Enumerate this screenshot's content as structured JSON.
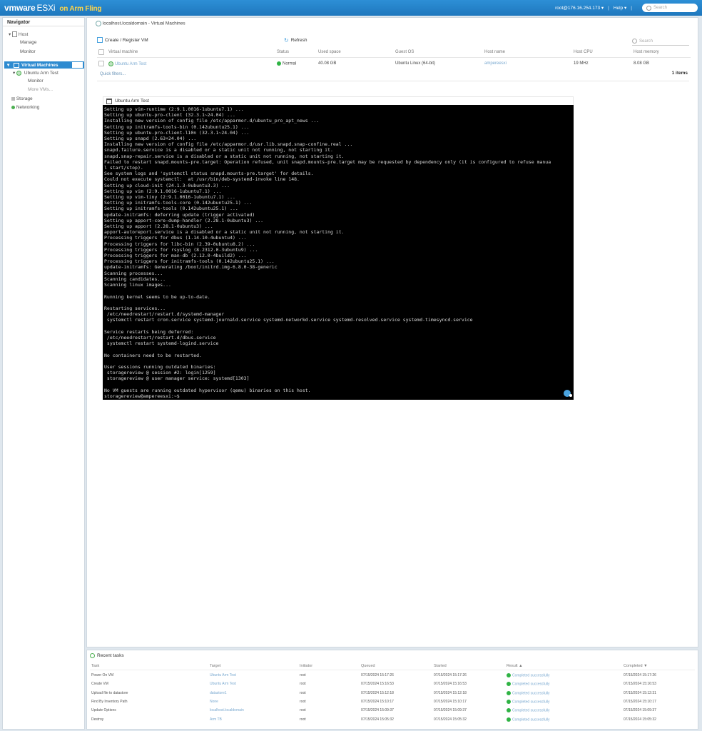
{
  "app": {
    "brand_vmware": "vmware",
    "brand_esxi": "ESXi",
    "brand_fling": "on Arm Fling",
    "user": "root@176.16.254.173 ▾",
    "help": "Help ▾",
    "search_placeholder": "Search"
  },
  "navigator": {
    "title": "Navigator",
    "host": "Host",
    "manage": "Manage",
    "monitor": "Monitor",
    "virtual_machines": "Virtual Machines",
    "vm_name": "Ubuntu Arm Test",
    "vm_monitor": "Monitor",
    "more_vms": "More VMs...",
    "storage": "Storage",
    "networking": "Networking"
  },
  "main": {
    "breadcrumb": "localhost.localdomain - Virtual Machines",
    "create_register": "Create / Register VM",
    "refresh": "Refresh",
    "search_placeholder": "Search",
    "columns": [
      "Virtual machine",
      "Status",
      "Used space",
      "Guest OS",
      "Host name",
      "Host CPU",
      "Host memory"
    ],
    "row": {
      "vm": "Ubuntu Arm Test",
      "status": "Normal",
      "used": "40.08 GB",
      "guest": "Ubuntu Linux (64-bit)",
      "host": "ampereesxi",
      "cpu": "19 MHz",
      "mem": "8.08 GB"
    },
    "quick_filters": "Quick filters...",
    "items_count": "1 items"
  },
  "console": {
    "title": "Ubuntu Arm Test",
    "text": "Setting up vim-runtime (2:9.1.0016-1ubuntu7.1) ...\nSetting up ubuntu-pro-client (32.3.1~24.04) ...\nInstalling new version of config file /etc/apparmor.d/ubuntu_pro_apt_news ...\nSetting up initramfs-tools-bin (0.142ubuntu25.1) ...\nSetting up ubuntu-pro-client-l10n (32.3.1~24.04) ...\nSetting up snapd (2.63+24.04) ...\nInstalling new version of config file /etc/apparmor.d/usr.lib.snapd.snap-confine.real ...\nsnapd.failure.service is a disabled or a static unit not running, not starting it.\nsnapd.snap-repair.service is a disabled or a static unit not running, not starting it.\nFailed to restart snapd.mounts-pre.target: Operation refused, unit snapd.mounts-pre.target may be requested by dependency only (it is configured to refuse manua\nl start/stop).\nSee system logs and 'systemctl status snapd.mounts-pre.target' for details.\nCould not execute systemctl:  at /usr/bin/deb-systemd-invoke line 148.\nSetting up cloud-init (24.1.3-0ubuntu3.3) ...\nSetting up vim (2:9.1.0016-1ubuntu7.1) ...\nSetting up vim-tiny (2:9.1.0016-1ubuntu7.1) ...\nSetting up initramfs-tools-core (0.142ubuntu25.1) ...\nSetting up initramfs-tools (0.142ubuntu25.1) ...\nupdate-initramfs: deferring update (trigger activated)\nSetting up apport-core-dump-handler (2.28.1-0ubuntu3) ...\nSetting up apport (2.28.1-0ubuntu3) ...\napport-autoreport.service is a disabled or a static unit not running, not starting it.\nProcessing triggers for dbus (1.14.10-4ubuntu4) ...\nProcessing triggers for libc-bin (2.39-0ubuntu8.2) ...\nProcessing triggers for rsyslog (8.2312.0-3ubuntu9) ...\nProcessing triggers for man-db (2.12.0-4build2) ...\nProcessing triggers for initramfs-tools (0.142ubuntu25.1) ...\nupdate-initramfs: Generating /boot/initrd.img-6.8.0-38-generic\nScanning processes...\nScanning candidates...\nScanning linux images...\n\nRunning kernel seems to be up-to-date.\n\nRestarting services...\n /etc/needrestart/restart.d/systemd-manager\n systemctl restart cron.service systemd-journald.service systemd-networkd.service systemd-resolved.service systemd-timesyncd.service\n\nService restarts being deferred:\n /etc/needrestart/restart.d/dbus.service\n systemctl restart systemd-logind.service\n\nNo containers need to be restarted.\n\nUser sessions running outdated binaries:\n storagereview @ session #2: login[1259]\n storagereview @ user manager service: systemd[1303]\n\nNo VM guests are running outdated hypervisor (qemu) binaries on this host.\nstoragereview@ampereesxi:~$"
  },
  "tasks": {
    "title": "Recent tasks",
    "columns": [
      "Task",
      "Target",
      "Initiator",
      "Queued",
      "Started",
      "Result ▲",
      "Completed ▼"
    ],
    "rows": [
      {
        "task": "Power On VM",
        "target": "Ubuntu Arm Test",
        "init": "root",
        "queued": "07/15/2024 15:17:26",
        "started": "07/15/2024 15:17:26",
        "result": "Completed successfully",
        "completed": "07/15/2024 15:17:26"
      },
      {
        "task": "Create VM",
        "target": "Ubuntu Arm Test",
        "init": "root",
        "queued": "07/15/2024 15:16:53",
        "started": "07/15/2024 15:16:53",
        "result": "Completed successfully",
        "completed": "07/15/2024 15:16:53"
      },
      {
        "task": "Upload file to datastore",
        "target": "datastore1",
        "init": "root",
        "queued": "07/15/2024 15:12:18",
        "started": "07/15/2024 15:12:18",
        "result": "Completed successfully",
        "completed": "07/15/2024 15:12:31"
      },
      {
        "task": "Find By Inventory Path",
        "target": "None",
        "init": "root",
        "queued": "07/15/2024 15:10:17",
        "started": "07/15/2024 15:10:17",
        "result": "Completed successfully",
        "completed": "07/15/2024 15:10:17"
      },
      {
        "task": "Update Options",
        "target": "localhost.localdomain",
        "init": "root",
        "queued": "07/15/2024 15:09:37",
        "started": "07/15/2024 15:09:37",
        "result": "Completed successfully",
        "completed": "07/15/2024 15:09:37"
      },
      {
        "task": "Destroy",
        "target": "Arm TB",
        "init": "root",
        "queued": "07/15/2024 15:05:32",
        "started": "07/15/2024 15:05:32",
        "result": "Completed successfully",
        "completed": "07/15/2024 15:05:32"
      }
    ]
  }
}
